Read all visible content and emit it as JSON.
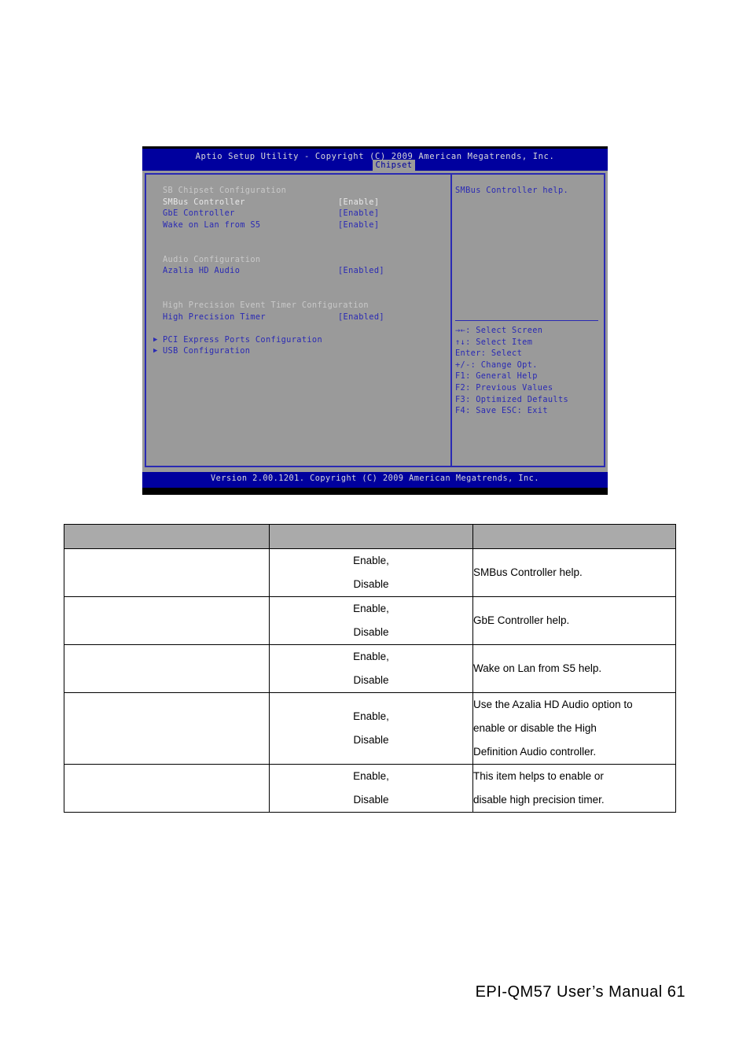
{
  "bios": {
    "title": "Aptio Setup Utility - Copyright (C) 2009 American Megatrends, Inc.",
    "tab": "Chipset",
    "footer": "Version 2.00.1201. Copyright (C) 2009 American Megatrends, Inc.",
    "menu": [
      {
        "type": "heading",
        "label": "SB Chipset Configuration",
        "value": ""
      },
      {
        "type": "selected",
        "label": "SMBus Controller",
        "value": "[Enable]"
      },
      {
        "type": "item",
        "label": "GbE Controller",
        "value": "[Enable]"
      },
      {
        "type": "item",
        "label": "Wake on Lan from S5",
        "value": "[Enable]"
      },
      {
        "type": "blank",
        "label": "",
        "value": ""
      },
      {
        "type": "blank",
        "label": "",
        "value": ""
      },
      {
        "type": "heading",
        "label": "Audio Configuration",
        "value": ""
      },
      {
        "type": "item",
        "label": "Azalia HD Audio",
        "value": "[Enabled]"
      },
      {
        "type": "blank",
        "label": "",
        "value": ""
      },
      {
        "type": "blank",
        "label": "",
        "value": ""
      },
      {
        "type": "heading",
        "label": "High Precision Event Timer Configuration",
        "value": ""
      },
      {
        "type": "item",
        "label": "High Precision Timer",
        "value": "[Enabled]"
      },
      {
        "type": "blank",
        "label": "",
        "value": ""
      },
      {
        "type": "submenu",
        "label": "PCI Express Ports Configuration",
        "value": ""
      },
      {
        "type": "submenu",
        "label": "USB Configuration",
        "value": ""
      }
    ],
    "help_text": "SMBus Controller help.",
    "keys": [
      "→←: Select Screen",
      "↑↓: Select Item",
      "Enter: Select",
      "+/-: Change Opt.",
      "F1: General Help",
      "F2: Previous Values",
      "F3: Optimized Defaults",
      "F4: Save  ESC: Exit"
    ]
  },
  "table": {
    "headers": [
      "",
      "",
      ""
    ],
    "rows": [
      {
        "name": "",
        "options": [
          "Enable,",
          "Disable"
        ],
        "description": [
          "SMBus Controller help."
        ]
      },
      {
        "name": "",
        "options": [
          "Enable,",
          "Disable"
        ],
        "description": [
          "GbE Controller help."
        ]
      },
      {
        "name": "",
        "options": [
          "Enable,",
          "Disable"
        ],
        "description": [
          "Wake on Lan from S5 help."
        ]
      },
      {
        "name": "",
        "options": [
          "Enable,",
          "Disable"
        ],
        "description": [
          "Use the Azalia HD Audio option to",
          "enable or disable the High",
          "Definition Audio controller."
        ]
      },
      {
        "name": "",
        "options": [
          "Enable,",
          "Disable"
        ],
        "description": [
          "This item helps to enable or",
          "disable high precision timer."
        ]
      }
    ]
  },
  "page": {
    "footer": "EPI-QM57  User’s  Manual 61"
  }
}
